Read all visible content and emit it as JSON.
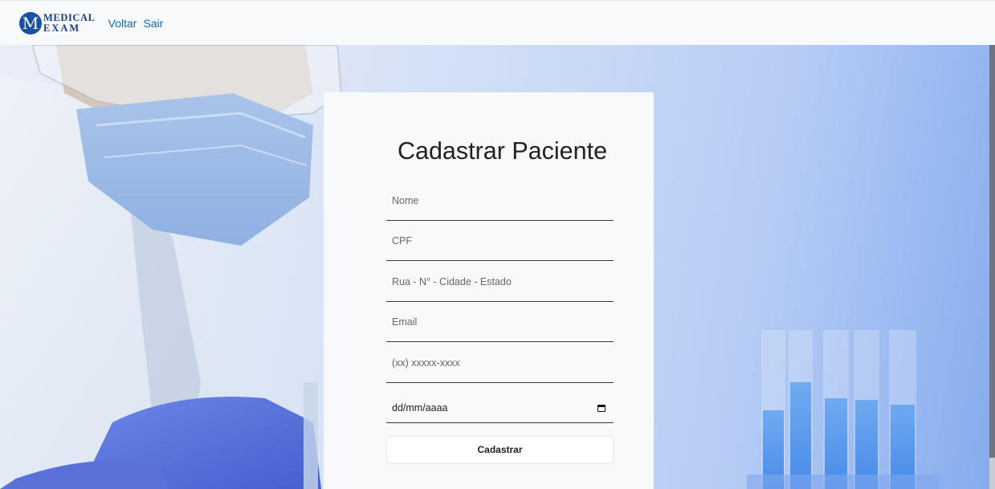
{
  "navbar": {
    "logo": {
      "initial": "M",
      "line1": "MEDICAL",
      "line2": "EXAM"
    },
    "links": [
      "Voltar",
      "Sair"
    ]
  },
  "form": {
    "title": "Cadastrar Paciente",
    "fields": {
      "nome": {
        "placeholder": "Nome"
      },
      "cpf": {
        "placeholder": "CPF"
      },
      "endereco": {
        "placeholder": "Rua - N° - Cidade - Estado"
      },
      "email": {
        "placeholder": "Email"
      },
      "telefone": {
        "placeholder": "(xx) xxxxx-xxxx"
      },
      "nascimento": {
        "placeholder": "dd/mm/aaaa"
      }
    },
    "submit_label": "Cadastrar"
  },
  "colors": {
    "brand": "#1a4fa8",
    "link": "#1565c0",
    "card_bg": "#f8f9fb"
  },
  "icons": {
    "date_picker": "calendar-icon"
  }
}
